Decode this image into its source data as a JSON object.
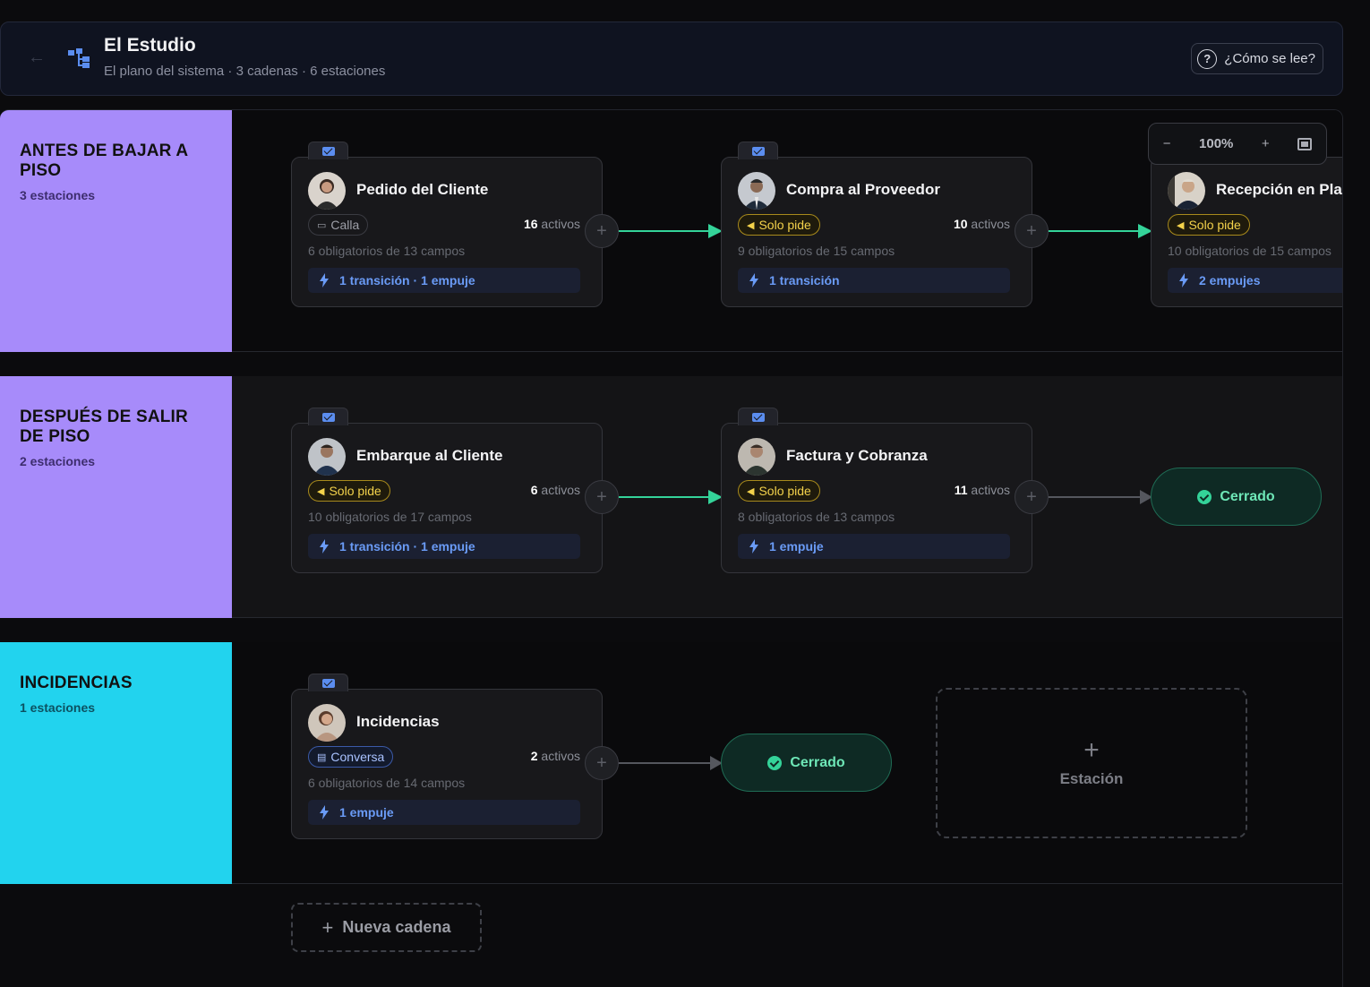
{
  "header": {
    "title": "El Estudio",
    "subtitle": "El plano del sistema · 3 cadenas · 6 estaciones",
    "help_label": "¿Cómo se lee?"
  },
  "zoom": {
    "level": "100%"
  },
  "lanes": [
    {
      "title": "ANTES DE BAJAR A PISO",
      "count": "3 estaciones",
      "color": "#a78bfa",
      "cards": [
        {
          "title": "Pedido del Cliente",
          "badge": "Calla",
          "badge_style": "gray",
          "actives_num": "16",
          "actives_label": "activos",
          "fields": "6 obligatorios de 13 campos",
          "transitions": "1 transición · 1 empuje"
        },
        {
          "title": "Compra al Proveedor",
          "badge": "Solo pide",
          "badge_style": "yellow",
          "actives_num": "10",
          "actives_label": "activos",
          "fields": "9 obligatorios de 15 campos",
          "transitions": "1 transición"
        },
        {
          "title": "Recepción en Planta",
          "badge": "Solo pide",
          "badge_style": "yellow",
          "actives_num": "",
          "actives_label": "",
          "fields": "10 obligatorios de 15 campos",
          "transitions": "2 empujes"
        }
      ]
    },
    {
      "title": "DESPUÉS DE SALIR DE PISO",
      "count": "2 estaciones",
      "color": "#a78bfa",
      "cards": [
        {
          "title": "Embarque al Cliente",
          "badge": "Solo pide",
          "badge_style": "yellow",
          "actives_num": "6",
          "actives_label": "activos",
          "fields": "10 obligatorios de 17 campos",
          "transitions": "1 transición · 1 empuje"
        },
        {
          "title": "Factura y Cobranza",
          "badge": "Solo pide",
          "badge_style": "yellow",
          "actives_num": "11",
          "actives_label": "activos",
          "fields": "8 obligatorios de 13 campos",
          "transitions": "1 empuje"
        }
      ],
      "end_label": "Cerrado"
    },
    {
      "title": "INCIDENCIAS",
      "count": "1 estaciones",
      "color": "#22d3ee",
      "cards": [
        {
          "title": "Incidencias",
          "badge": "Conversa",
          "badge_style": "blue",
          "actives_num": "2",
          "actives_label": "activos",
          "fields": "6 obligatorios de 14 campos",
          "transitions": "1 empuje"
        }
      ],
      "end_label": "Cerrado",
      "add_station_label": "Estación"
    }
  ],
  "new_chain_label": "Nueva cadena",
  "colors": {
    "accent_green": "#34d399",
    "link_blue": "#6a9bf6",
    "badge_yellow": "#f3d24b"
  }
}
